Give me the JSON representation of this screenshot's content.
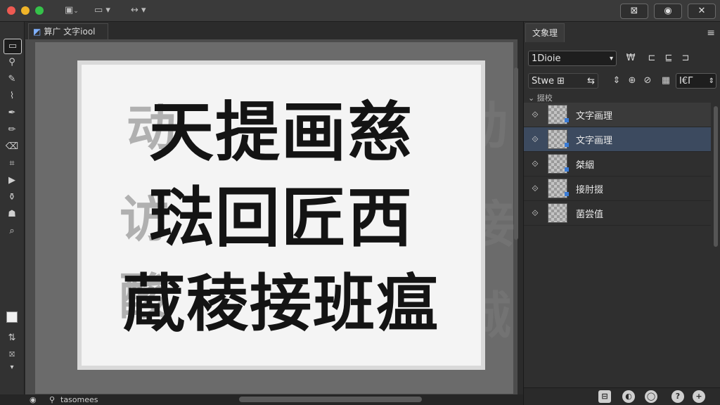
{
  "titlebar": {
    "buttons": [
      "⊠",
      "◉",
      "✕"
    ],
    "icons": {
      "doc": "document-icon",
      "display": "display-icon",
      "transform": "transform-icon"
    }
  },
  "doc_tab": {
    "label": "算广  文字iool"
  },
  "canvas": {
    "rows": [
      "天提画慈",
      "琺回匠西",
      "蔵稜接班瘟"
    ],
    "ghost_rows": [
      "动",
      "访",
      "酸",
      "接",
      "诚"
    ]
  },
  "status": {
    "text": "tasomees"
  },
  "panel": {
    "tab": "文象理",
    "select_value": "1Dioie",
    "row2_label": "Stwe ⊞",
    "row2_field": "I€Г",
    "section_label": "⌄ 掇校",
    "layers": [
      {
        "name": "文字画理",
        "state": "hover"
      },
      {
        "name": "文字画理",
        "state": "selected"
      },
      {
        "name": "桀絪",
        "state": "normal"
      },
      {
        "name": "接肘掇",
        "state": "normal"
      },
      {
        "name": "菌尝值",
        "state": "normal"
      }
    ]
  },
  "colors": {
    "accent": "#3a7bd5",
    "selected_layer": "#3c4a5f"
  }
}
